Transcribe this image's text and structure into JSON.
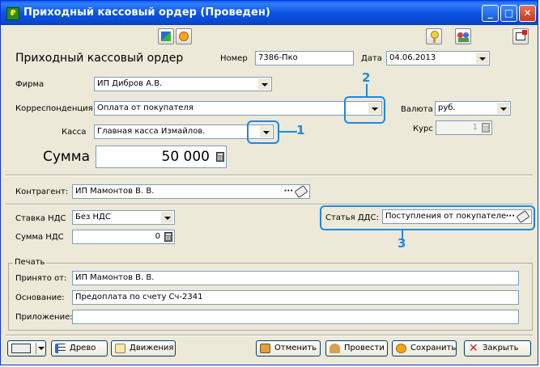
{
  "window": {
    "title": "Приходный кассовый ордер (Проведен)"
  },
  "form": {
    "heading": "Приходный кассовый ордер",
    "number_label": "Номер",
    "number_value": "7386-Пко",
    "date_label": "Дата",
    "date_value": "04.06.2013",
    "firm_label": "Фирма",
    "firm_value": "ИП Дибров А.В.",
    "corr_label": "Корреспонденция",
    "corr_value": "Оплата от покупателя",
    "currency_label": "Валюта",
    "currency_value": "руб.",
    "rate_label": "Курс",
    "rate_value": "1",
    "cash_label": "Касса",
    "cash_value": "Главная касса Измайлов.",
    "sum_label": "Сумма",
    "sum_value": "50 000",
    "contractor_label": "Контрагент:",
    "contractor_value": "ИП Мамонтов В. В.",
    "vat_rate_label": "Ставка НДС",
    "vat_rate_value": "Без НДС",
    "vat_sum_label": "Сумма НДС",
    "vat_sum_value": "0",
    "dds_label": "Статья ДДС:",
    "dds_value": "Поступления от покупателе",
    "print_label": "Печать",
    "received_label": "Принято от:",
    "received_value": "ИП Мамонтов В. В.",
    "basis_label": "Основание:",
    "basis_value": "Предоплата по счету Сч-2341",
    "attachment_label": "Приложение:",
    "attachment_value": ""
  },
  "annotations": {
    "n1": "1",
    "n2": "2",
    "n3": "3"
  },
  "buttons": {
    "tree": "Древо",
    "moves": "Движения",
    "cancel": "Отменить",
    "post": "Провести",
    "save": "Сохранить",
    "close": "Закрыть"
  },
  "colors": {
    "titlebar": "#0a54e3",
    "callout": "#1e88e5",
    "face": "#ece9d8"
  },
  "icons": {
    "toolbar": [
      "structure-icon",
      "refresh-icon",
      "key-icon",
      "users-icon",
      "export-icon"
    ],
    "bottom": [
      "print-icon",
      "tree-icon",
      "moves-icon",
      "cancel-icon",
      "post-icon",
      "save-icon",
      "close-icon"
    ]
  }
}
